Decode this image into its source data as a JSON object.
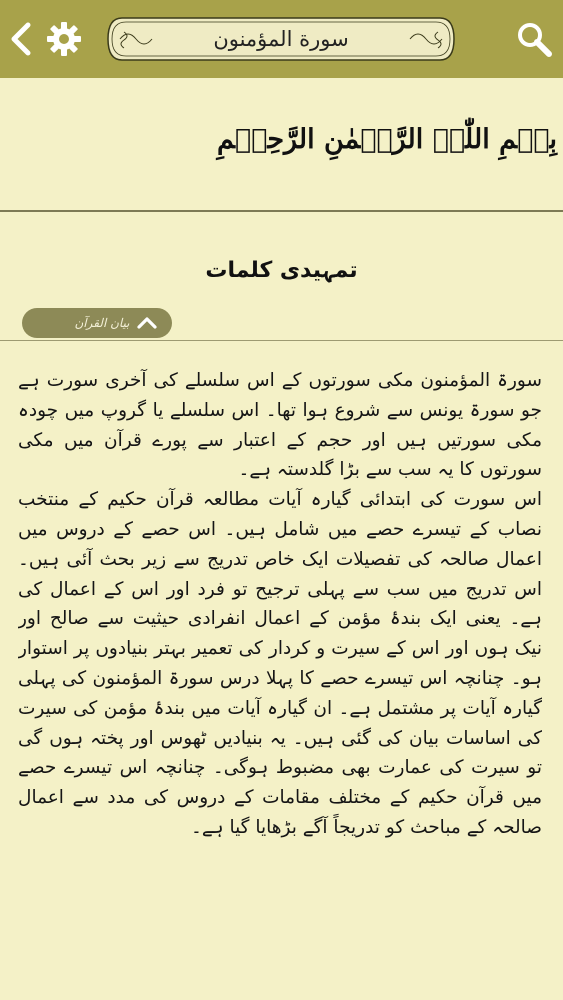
{
  "header": {
    "title": "سورة المؤمنون",
    "back_icon": "chevron-left-icon",
    "settings_icon": "gear-icon",
    "search_icon": "search-icon"
  },
  "bismillah": "بِسۡمِ اللّٰہِ الرَّحۡمٰنِ الرَّحِیۡمِ",
  "section": {
    "heading": "تمہیدی کلمات",
    "source_label": "بیان القرآن",
    "source_toggle_icon": "chevron-up-icon"
  },
  "body": {
    "paragraphs": [
      "سورۃ المؤمنون مکی سورتوں کے اس سلسلے کی آخری سورت ہے جو سورۃ یونس سے شروع ہوا تھا۔ اس سلسلے یا گروپ میں چودہ مکی سورتیں ہیں اور حجم کے اعتبار سے پورے قرآن میں مکی سورتوں کا یہ سب سے بڑا گلدستہ ہے۔",
      "اس سورت کی ابتدائی گیارہ آیات مطالعہ قرآن حکیم کے منتخب نصاب کے تیسرے حصے میں شامل ہیں۔ اس حصے کے دروس میں اعمال صالحہ کی تفصیلات ایک خاص تدریج سے زیر بحث آئی ہیں۔ اس تدریج میں سب سے پہلی ترجیح تو فرد اور اس کے اعمال کی ہے۔ یعنی ایک بندۂ مؤمن کے اعمال انفرادی حیثیت سے صالح اور نیک ہوں اور اس کے سیرت و کردار کی تعمیر بہتر بنیادوں پر استوار ہو۔ چنانچہ اس تیسرے حصے کا پہلا درس سورۃ المؤمنون کی پہلی گیارہ آیات پر مشتمل ہے۔ ان گیارہ آیات میں بندۂ مؤمن کی سیرت کی اساسات بیان کی گئی ہیں۔ یہ بنیادیں ٹھوس اور پختہ ہوں گی تو سیرت کی عمارت بھی مضبوط ہوگی۔ چنانچہ اس تیسرے حصے میں قرآن حکیم کے مختلف مقامات کے دروس کی مدد سے اعمال صالحہ کے مباحث کو تدریجاً آگے بڑھایا گیا ہے۔"
    ]
  },
  "colors": {
    "header_bg": "#a8a24a",
    "page_bg": "#f4f1c7",
    "pill_bg": "#8d8a57"
  }
}
